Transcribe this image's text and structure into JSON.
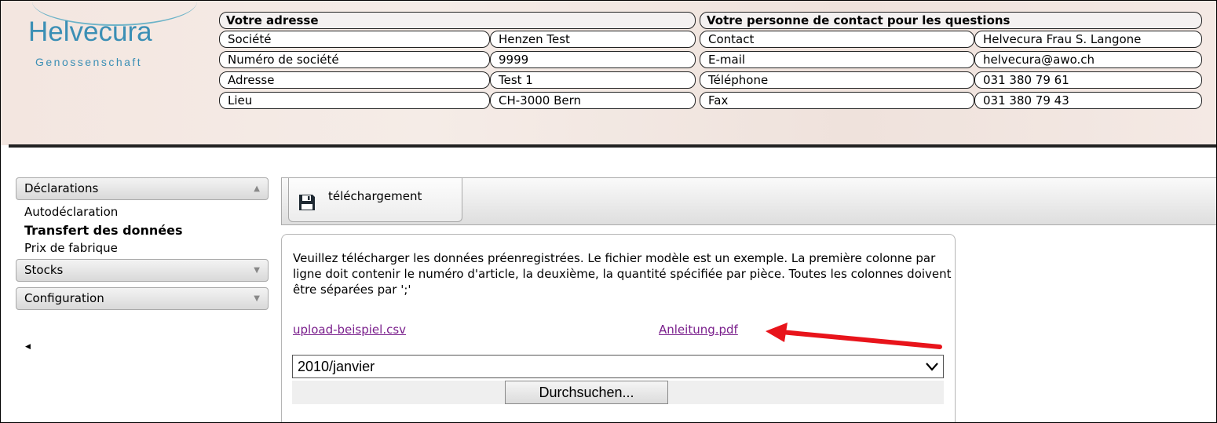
{
  "logo": {
    "name": "Helvecura",
    "subtitle": "Genossenschaft"
  },
  "address": {
    "title": "Votre adresse",
    "rows": [
      {
        "label": "Société",
        "value": "Henzen Test"
      },
      {
        "label": "Numéro de société",
        "value": "9999"
      },
      {
        "label": "Adresse",
        "value": "Test 1"
      },
      {
        "label": "Lieu",
        "value": "CH-3000 Bern"
      }
    ]
  },
  "contact": {
    "title": "Votre personne de contact pour les questions",
    "rows": [
      {
        "label": "Contact",
        "value": "Helvecura Frau S. Langone"
      },
      {
        "label": "E-mail",
        "value": "helvecura@awo.ch"
      },
      {
        "label": "Téléphone",
        "value": "031 380 79 61"
      },
      {
        "label": "Fax",
        "value": "031 380 79 43"
      }
    ]
  },
  "sidebar": {
    "sections": [
      {
        "label": "Déclarations",
        "expanded": true,
        "items": [
          "Autodéclaration",
          "Transfert des données",
          "Prix de fabrique"
        ],
        "active_item": "Transfert des données"
      },
      {
        "label": "Stocks",
        "expanded": false
      },
      {
        "label": "Configuration",
        "expanded": false
      }
    ]
  },
  "toolbar": {
    "download_label": "téléchargement",
    "download_icon": "floppy-disk-icon"
  },
  "upload": {
    "instructions": "Veuillez télécharger les données préenregistrées. Le fichier modèle est un exemple. La première colonne par ligne doit contenir le numéro d'article, la deuxième, la quantité spécifiée par pièce. Toutes les colonnes doivent être séparées par ';'",
    "sample_link": "upload-beispiel.csv",
    "guide_link": "Anleitung.pdf",
    "period_selected": "2010/janvier",
    "browse_label": "Durchsuchen..."
  },
  "colors": {
    "brand": "#3b8fb5",
    "link_visited": "#7a1f8c",
    "annotation_arrow": "#e8141b"
  }
}
